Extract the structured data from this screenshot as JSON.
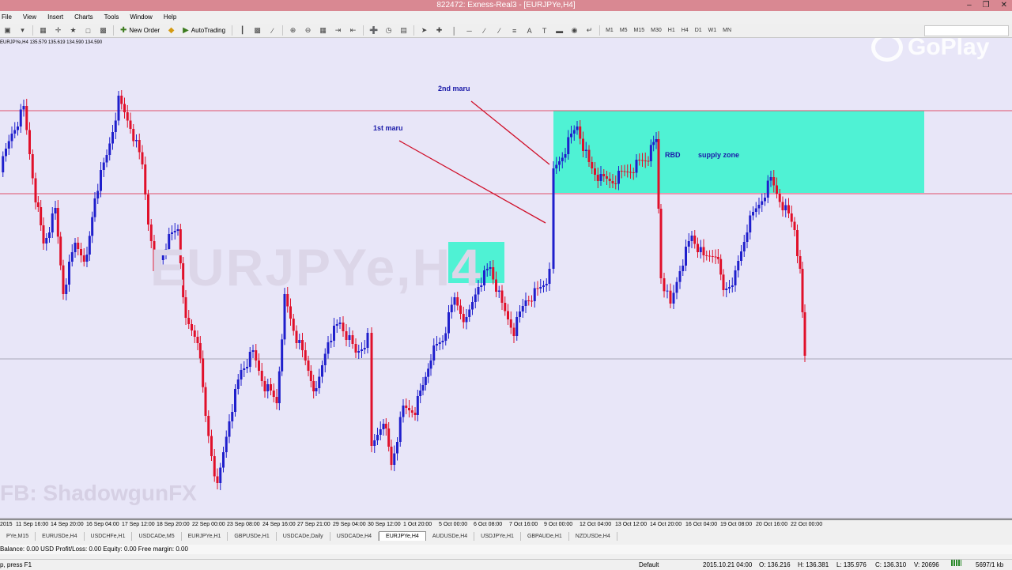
{
  "window": {
    "title": "822472: Exness-Real3 - [EURJPYe,H4]"
  },
  "menu": [
    "File",
    "View",
    "Insert",
    "Charts",
    "Tools",
    "Window",
    "Help"
  ],
  "toolbar": {
    "new_order_label": "New Order",
    "autotrading_label": "AutoTrading",
    "timeframes": [
      "M1",
      "M5",
      "M15",
      "M30",
      "H1",
      "H4",
      "D1",
      "W1",
      "MN"
    ]
  },
  "chart": {
    "info": "EURJPYe,H4  135.579 135.619 134.590 134.590",
    "watermark": "EURJPYe,H4",
    "fb_watermark": "FB: ShadowgunFX",
    "logo_text": "GoPlay",
    "annotations": {
      "second_maru": "2nd maru",
      "first_maru": "1st maru",
      "rbd": "RBD",
      "supply_zone": "supply zone"
    },
    "colors": {
      "bull": "#1f1fcc",
      "bear": "#e0102a",
      "zone": "#4ff2d4",
      "background": "#e8e6f8"
    }
  },
  "time_axis": [
    "2015",
    "11 Sep 16:00",
    "14 Sep 20:00",
    "16 Sep 04:00",
    "17 Sep 12:00",
    "18 Sep 20:00",
    "22 Sep 00:00",
    "23 Sep 08:00",
    "24 Sep 16:00",
    "27 Sep 21:00",
    "29 Sep 04:00",
    "30 Sep 12:00",
    "1 Oct 20:00",
    "5 Oct 00:00",
    "6 Oct 08:00",
    "7 Oct 16:00",
    "9 Oct 00:00",
    "12 Oct 04:00",
    "13 Oct 12:00",
    "14 Oct 20:00",
    "16 Oct 04:00",
    "19 Oct 08:00",
    "20 Oct 16:00",
    "22 Oct 00:00"
  ],
  "tabs": [
    "PYe,M15",
    "EURUSDe,H4",
    "USDCHFe,H1",
    "USDCADe,M5",
    "EURJPYe,H1",
    "GBPUSDe,H1",
    "USDCADe,Daily",
    "USDCADe,H4",
    "EURJPYe,H4",
    "AUDUSDe,H4",
    "USDJPYe,H1",
    "GBPAUDe,H1",
    "NZDUSDe,H4"
  ],
  "active_tab": "EURJPYe,H4",
  "account": {
    "summary": "Balance: 0.00 USD  Profit/Loss: 0.00  Equity: 0.00  Free margin: 0.00"
  },
  "status": {
    "help": "p, press F1",
    "profile": "Default",
    "datetime": "2015.10.21 04:00",
    "open": "O: 136.216",
    "high": "H: 136.381",
    "low": "L: 135.976",
    "close": "C: 136.310",
    "volume": "V: 20696",
    "traffic": "5697/1 kb"
  }
}
